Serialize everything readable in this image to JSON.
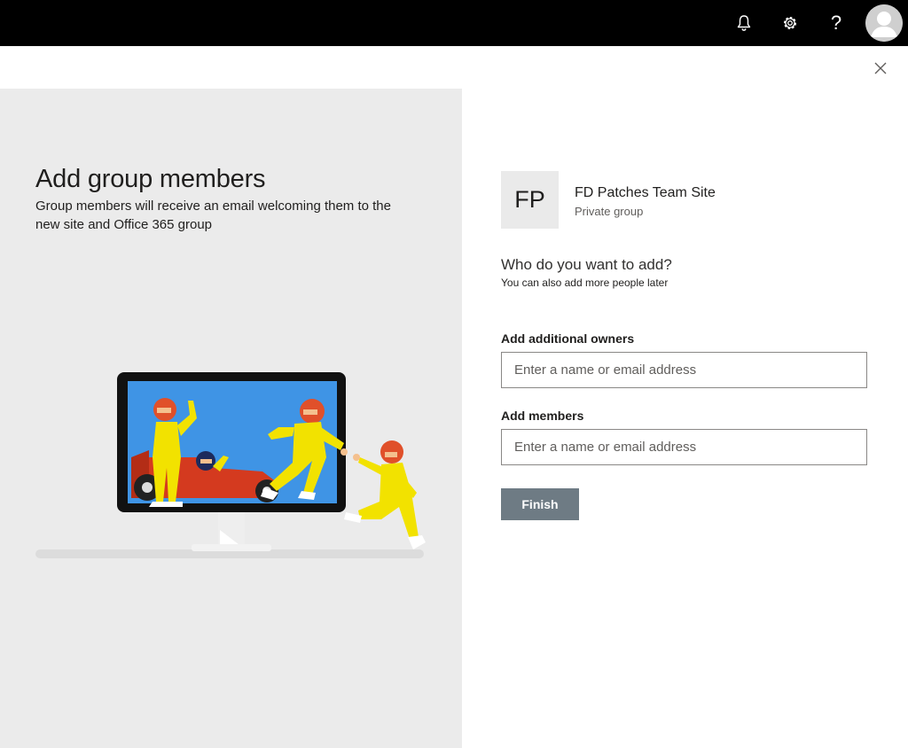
{
  "topbar": {
    "icons": [
      "bell-icon",
      "gear-icon",
      "help-icon",
      "avatar-icon"
    ],
    "help_glyph": "?"
  },
  "intro": {
    "title": "Add group members",
    "description": "Group members will receive an email welcoming them to the new site and Office 365 group"
  },
  "site": {
    "initials": "FP",
    "name": "FD Patches Team Site",
    "type": "Private group",
    "tile_color": "#eaeaea"
  },
  "add": {
    "title": "Who do you want to add?",
    "subtitle": "You can also add more people later",
    "owners_label": "Add additional owners",
    "owners_placeholder": "Enter a name or email address",
    "owners_value": "",
    "members_label": "Add members",
    "members_placeholder": "Enter a name or email address",
    "members_value": "",
    "finish_label": "Finish"
  },
  "colors": {
    "topbar": "#000000",
    "left_panel": "#ebebeb",
    "finish_button": "#6e7b84",
    "illustration_screen": "#3f94e5",
    "illustration_suit": "#f2e200",
    "illustration_helmet": "#e0502a",
    "illustration_car": "#d43a1f"
  }
}
